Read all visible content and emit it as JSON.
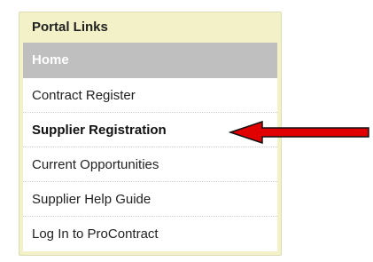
{
  "panel": {
    "title": "Portal Links",
    "items": [
      {
        "label": "Home"
      },
      {
        "label": "Contract Register"
      },
      {
        "label": "Supplier Registration"
      },
      {
        "label": "Current Opportunities"
      },
      {
        "label": "Supplier Help Guide"
      },
      {
        "label": "Log In to ProContract"
      }
    ]
  },
  "annotation": {
    "arrow_color": "#e00000",
    "icon": "red-arrow-left"
  },
  "colors": {
    "panel_bg": "#f2f1c8",
    "home_bg": "#bfbfbf"
  }
}
